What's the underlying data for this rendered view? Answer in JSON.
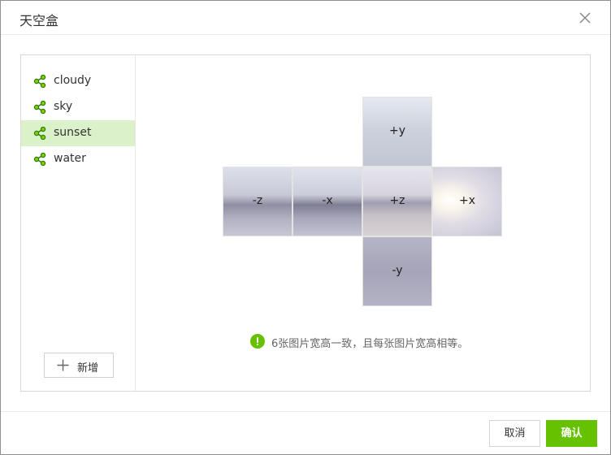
{
  "dialog": {
    "title": "天空盒",
    "close_icon": "close-icon"
  },
  "sidebar": {
    "items": [
      {
        "label": "cloudy",
        "icon": "share-icon",
        "active": false
      },
      {
        "label": "sky",
        "icon": "share-icon",
        "active": false
      },
      {
        "label": "sunset",
        "icon": "share-icon",
        "active": true
      },
      {
        "label": "water",
        "icon": "share-icon",
        "active": false
      }
    ],
    "add_button": {
      "label": "新增",
      "icon": "plus-icon"
    }
  },
  "cubemap": {
    "faces": {
      "pos_y": "+y",
      "neg_z": "-z",
      "neg_x": "-x",
      "pos_z": "+z",
      "pos_x": "+x",
      "neg_y": "-y"
    }
  },
  "hint": {
    "icon": "warning-icon",
    "text": "6张图片宽高一致，且每张图片宽高相等。"
  },
  "footer": {
    "cancel_label": "取消",
    "ok_label": "确认"
  },
  "colors": {
    "accent": "#66c200",
    "active_bg": "#dbf1c9",
    "icon_green": "#2f7d00"
  }
}
